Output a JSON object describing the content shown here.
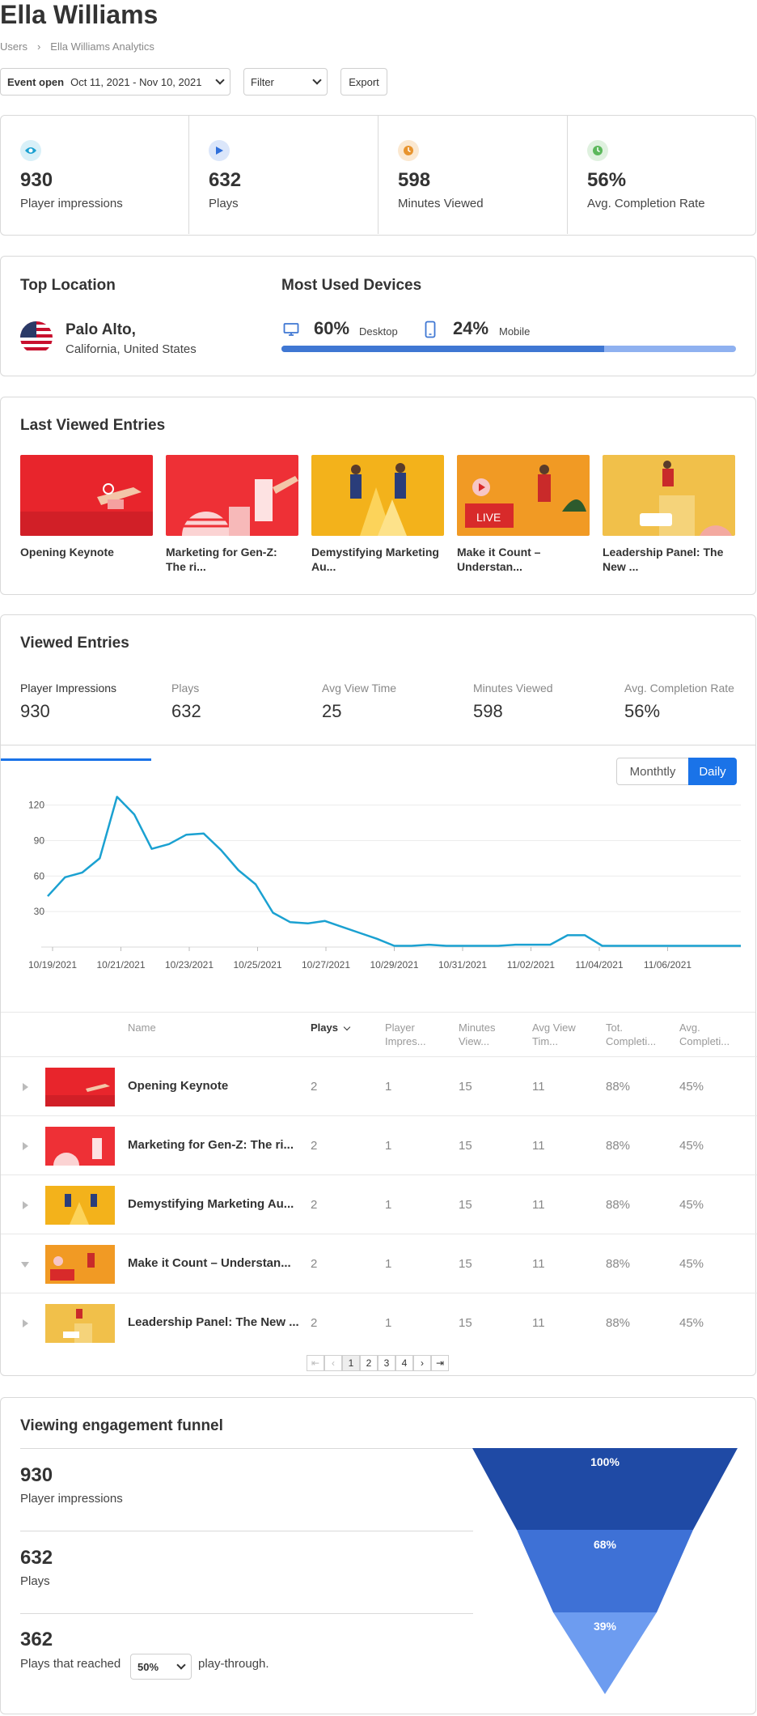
{
  "header": {
    "title": "Ella Williams",
    "breadcrumb": [
      "Users",
      "Ella Williams Analytics"
    ],
    "event_label": "Event open",
    "date_range": "Oct 11, 2021 - Nov 10, 2021",
    "filter_label": "Filter",
    "export_label": "Export"
  },
  "kpis": [
    {
      "value": "930",
      "label": "Player impressions",
      "icon": "eye-icon",
      "color": "#1ba1d1",
      "bg": "#d8f0f8"
    },
    {
      "value": "632",
      "label": "Plays",
      "icon": "play-icon",
      "color": "#2f6fdb",
      "bg": "#dbe6fa"
    },
    {
      "value": "598",
      "label": "Minutes Viewed",
      "icon": "clock-icon",
      "color": "#e8942e",
      "bg": "#fbe8d0"
    },
    {
      "value": "56%",
      "label": "Avg. Completion Rate",
      "icon": "clock-check-icon",
      "color": "#5cb85c",
      "bg": "#dff1df"
    }
  ],
  "location": {
    "title": "Top Location",
    "city": "Palo Alto,",
    "region": "California, United States"
  },
  "devices": {
    "title": "Most Used Devices",
    "items": [
      {
        "pct": "60%",
        "label": "Desktop",
        "icon": "desktop-icon"
      },
      {
        "pct": "24%",
        "label": "Mobile",
        "icon": "mobile-icon"
      }
    ],
    "desktop_share": 0.71
  },
  "last_viewed": {
    "title": "Last Viewed Entries",
    "items": [
      {
        "title": "Opening Keynote",
        "bg": "#e8252c"
      },
      {
        "title": "Marketing for Gen-Z: The ri...",
        "bg": "#ee3036"
      },
      {
        "title": "Demystifying Marketing Au...",
        "bg": "#f3b21b"
      },
      {
        "title": "Make it Count – Understan...",
        "bg": "#f19a24"
      },
      {
        "title": "Leadership Panel: The New ...",
        "bg": "#f1c04a"
      }
    ]
  },
  "viewed": {
    "title": "Viewed Entries",
    "tabs": [
      {
        "label": "Player Impressions",
        "value": "930"
      },
      {
        "label": "Plays",
        "value": "632"
      },
      {
        "label": "Avg View Time",
        "value": "25"
      },
      {
        "label": "Minutes Viewed",
        "value": "598"
      },
      {
        "label": "Avg. Completion Rate",
        "value": "56%"
      }
    ],
    "toggle": {
      "monthly": "Monthtly",
      "daily": "Daily"
    }
  },
  "chart_data": {
    "type": "line",
    "title": "",
    "xlabel": "",
    "ylabel": "",
    "ylim": [
      0,
      130
    ],
    "y_ticks": [
      30,
      60,
      90,
      120
    ],
    "x_ticks": [
      "10/19/2021",
      "10/21/2021",
      "10/23/2021",
      "10/25/2021",
      "10/27/2021",
      "10/29/2021",
      "10/31/2021",
      "11/02/2021",
      "11/04/2021",
      "11/06/2021"
    ],
    "x": [
      "10/19",
      "10/19.5",
      "10/20",
      "10/20.5",
      "10/21",
      "10/21.5",
      "10/22",
      "10/22.5",
      "10/23",
      "10/23.5",
      "10/24",
      "10/24.5",
      "10/25",
      "10/25.5",
      "10/26",
      "10/26.5",
      "10/27",
      "10/27.5",
      "10/28",
      "10/28.5",
      "10/29",
      "10/29.5",
      "10/30",
      "10/30.5",
      "10/31",
      "10/31.5",
      "11/01",
      "11/01.5",
      "11/02",
      "11/02.5",
      "11/03",
      "11/03.5",
      "11/04",
      "11/04.5",
      "11/05",
      "11/05.5",
      "11/06",
      "11/06.5",
      "11/07",
      "11/07.5",
      "11/08"
    ],
    "series": [
      {
        "values": [
          43,
          59,
          63,
          75,
          127,
          112,
          83,
          87,
          95,
          96,
          82,
          65,
          53,
          29,
          21,
          20,
          22,
          17,
          12,
          7,
          1,
          1,
          2,
          1,
          1,
          1,
          1,
          2,
          2,
          2,
          10,
          10,
          1,
          1,
          1,
          1,
          1,
          1,
          1,
          1,
          1
        ],
        "color": "#1ba1d1"
      }
    ]
  },
  "table": {
    "headers": [
      "Name",
      "Plays",
      "Player Impres...",
      "Minutes View...",
      "Avg View Tim...",
      "Tot. Completi...",
      "Avg. Completi..."
    ],
    "rows": [
      {
        "name": "Opening Keynote",
        "plays": "2",
        "impr": "1",
        "minutes": "15",
        "avg_view": "11",
        "tot": "88%",
        "avg": "45%",
        "expanded": false
      },
      {
        "name": "Marketing for Gen-Z: The ri...",
        "plays": "2",
        "impr": "1",
        "minutes": "15",
        "avg_view": "11",
        "tot": "88%",
        "avg": "45%",
        "expanded": false
      },
      {
        "name": "Demystifying Marketing Au...",
        "plays": "2",
        "impr": "1",
        "minutes": "15",
        "avg_view": "11",
        "tot": "88%",
        "avg": "45%",
        "expanded": false
      },
      {
        "name": "Make it Count – Understan...",
        "plays": "2",
        "impr": "1",
        "minutes": "15",
        "avg_view": "11",
        "tot": "88%",
        "avg": "45%",
        "expanded": true
      },
      {
        "name": "Leadership Panel: The New ...",
        "plays": "2",
        "impr": "1",
        "minutes": "15",
        "avg_view": "11",
        "tot": "88%",
        "avg": "45%",
        "expanded": false
      }
    ],
    "pagination": [
      "1",
      "2",
      "3",
      "4"
    ]
  },
  "funnel": {
    "title": "Viewing engagement funnel",
    "stages": [
      {
        "value": "930",
        "label": "Player impressions",
        "pct": "100%"
      },
      {
        "value": "632",
        "label": "Plays",
        "pct": "68%"
      },
      {
        "value": "362",
        "label": "Plays that reached",
        "pct": "39%"
      }
    ],
    "threshold": "50%",
    "suffix": "play-through."
  }
}
